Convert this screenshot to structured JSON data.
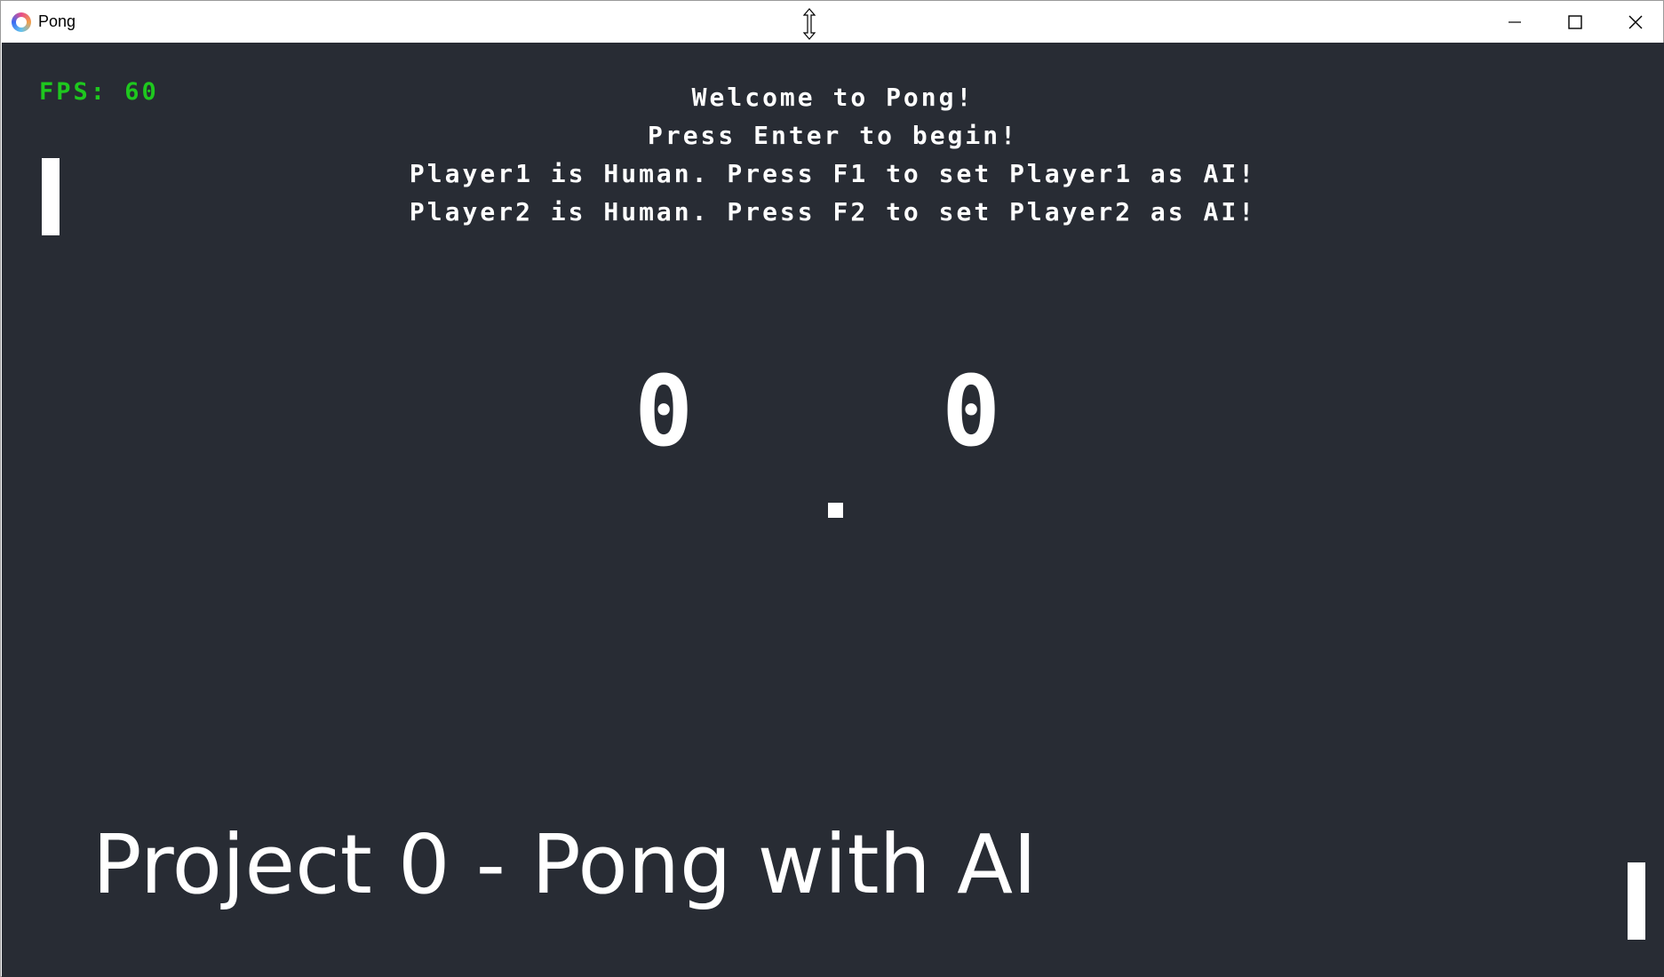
{
  "window": {
    "title": "Pong",
    "controls": {
      "minimize_icon": "minimize-icon",
      "maximize_icon": "maximize-icon",
      "close_icon": "close-icon"
    }
  },
  "game": {
    "fps_label": "FPS: 60",
    "messages": [
      "Welcome to Pong!",
      "Press Enter to begin!",
      "Player1 is Human. Press F1 to set Player1 as AI!",
      "Player2 is Human. Press F2 to set Player2 as AI!"
    ],
    "score": {
      "player1": "0",
      "player2": "0"
    },
    "colors": {
      "background": "#282c34",
      "fps": "#1ec81e",
      "foreground": "#ffffff"
    }
  },
  "caption": "Project 0 - Pong with AI"
}
